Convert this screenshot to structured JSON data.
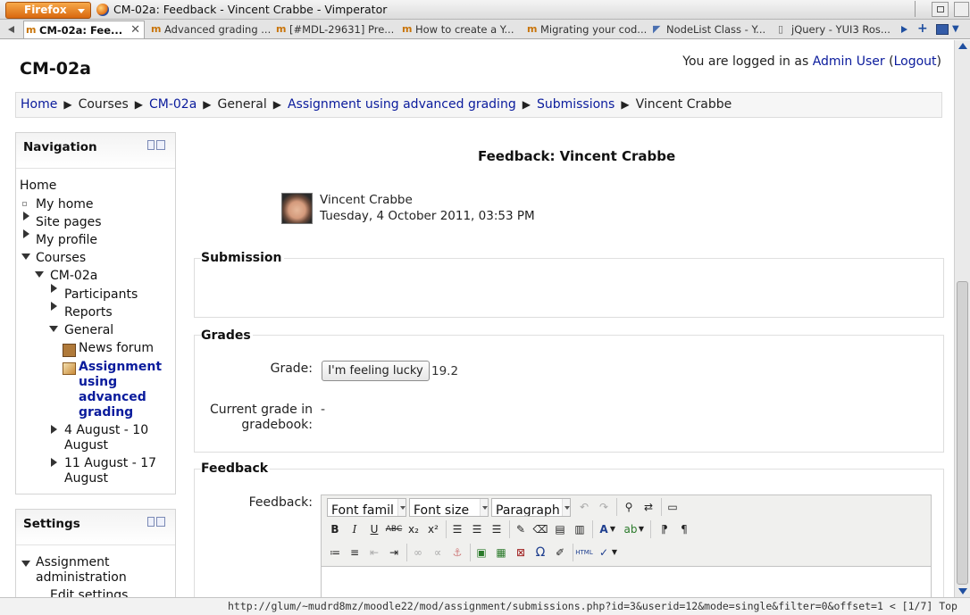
{
  "browser": {
    "menu_button_label": "Firefox",
    "window_title": "CM-02a: Feedback - Vincent Crabbe - Vimperator",
    "tabs": [
      {
        "label": "CM-02a: Fee...",
        "active": true,
        "icon": "moodle-icon"
      },
      {
        "label": "Advanced grading ...",
        "active": false,
        "icon": "moodle-icon"
      },
      {
        "label": "[#MDL-29631] Pre...",
        "active": false,
        "icon": "moodle-icon"
      },
      {
        "label": "How to create a Y...",
        "active": false,
        "icon": "moodle-icon"
      },
      {
        "label": "Migrating your cod...",
        "active": false,
        "icon": "moodle-icon"
      },
      {
        "label": "NodeList Class - Y...",
        "active": false,
        "icon": "yui-icon"
      },
      {
        "label": "jQuery - YUI3 Ros...",
        "active": false,
        "icon": "page-icon"
      }
    ],
    "status_url": "http://glum/~mudrd8mz/moodle22/mod/assignment/submissions.php?id=3&userid=12&mode=single&filter=0&offset=1 < [1/7] Top"
  },
  "site": {
    "name": "CM-02a",
    "login_prefix": "You are logged in as",
    "login_user": "Admin User",
    "logout_label": "Logout",
    "paren_open": "(",
    "paren_close": ")"
  },
  "breadcrumb": [
    "Home",
    "Courses",
    "CM-02a",
    "General",
    "Assignment using advanced grading",
    "Submissions",
    "Vincent Crabbe"
  ],
  "breadcrumb_separator": "▶",
  "navigation": {
    "title": "Navigation",
    "home": "Home",
    "my_home": "My home",
    "site_pages": "Site pages",
    "my_profile": "My profile",
    "courses": "Courses",
    "course": "CM-02a",
    "participants": "Participants",
    "reports": "Reports",
    "general": "General",
    "news_forum": "News forum",
    "assignment_lines": [
      "Assignment",
      "using",
      "advanced",
      "grading"
    ],
    "week1_lines": [
      "4 August - 10",
      "August"
    ],
    "week2_lines": [
      "11 August - 17",
      "August"
    ]
  },
  "settings": {
    "title": "Settings",
    "assignment_admin_lines": [
      "Assignment",
      "administration"
    ],
    "edit_settings": "Edit settings"
  },
  "main": {
    "heading": "Feedback: Vincent Crabbe",
    "student_name": "Vincent Crabbe",
    "submission_date": "Tuesday, 4 October 2011, 03:53 PM",
    "submission_legend": "Submission",
    "grades_legend": "Grades",
    "grade_label": "Grade:",
    "grade_button": "I'm feeling lucky",
    "grade_value": "19.2",
    "current_grade_label_lines": [
      "Current grade in",
      "gradebook:"
    ],
    "current_grade_value": "-",
    "feedback_legend": "Feedback",
    "feedback_label": "Feedback:"
  },
  "editor": {
    "font_family": "Font famil",
    "font_size": "Font size",
    "paragraph": "Paragraph",
    "row2_buttons": [
      "bold-icon",
      "italic-icon",
      "underline-icon",
      "strikethrough-icon",
      "subscript-icon",
      "superscript-icon",
      "align-left-icon",
      "align-center-icon",
      "align-right-icon",
      "cleanup-icon",
      "eraser-icon",
      "paste-text-icon",
      "paste-word-icon",
      "text-color-icon",
      "highlight-color-icon",
      "ltr-icon",
      "rtl-icon"
    ],
    "row3_buttons": [
      "bullet-list-icon",
      "numbered-list-icon",
      "outdent-icon",
      "indent-icon",
      "link-icon",
      "unlink-icon",
      "anchor-icon",
      "image-icon",
      "media-icon",
      "nolink-icon",
      "special-char-icon",
      "edit-icon",
      "html-icon",
      "spellcheck-icon"
    ]
  }
}
